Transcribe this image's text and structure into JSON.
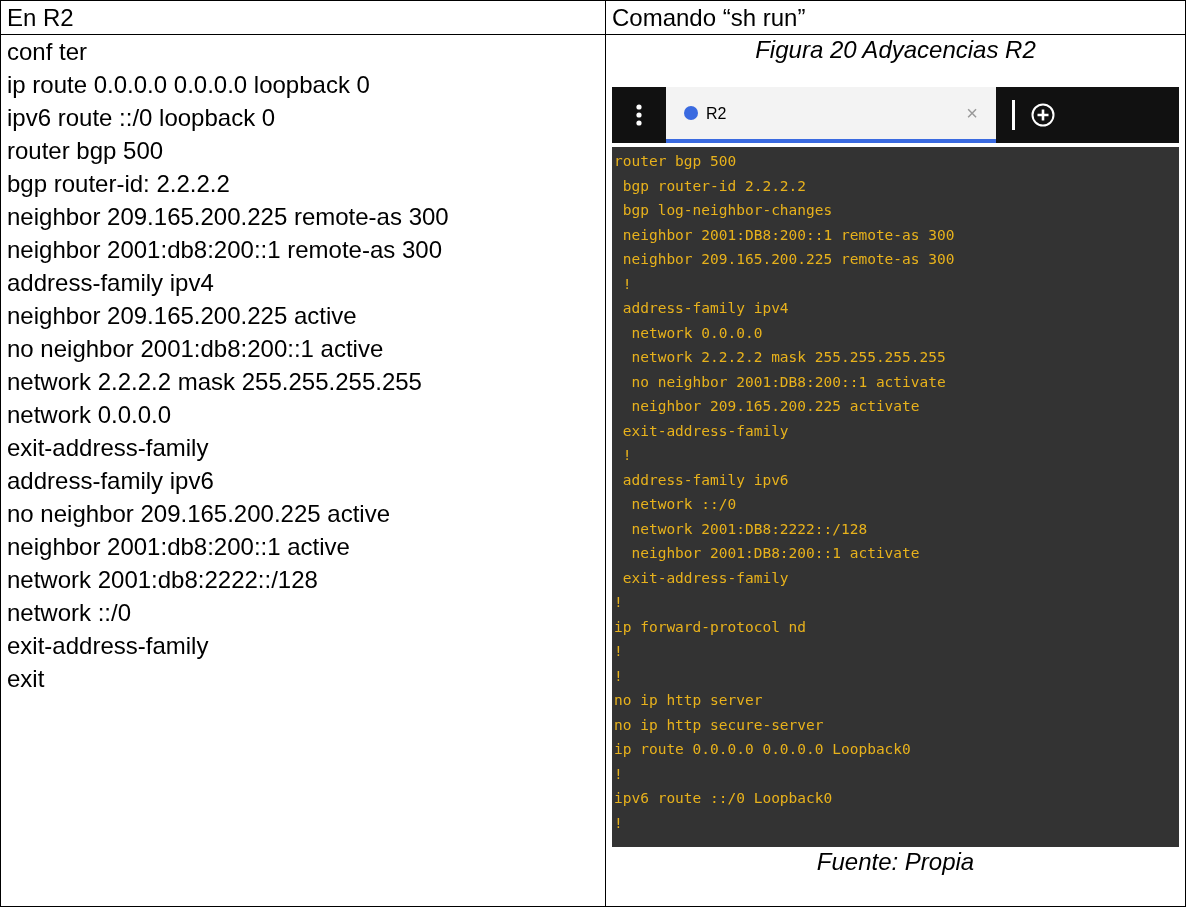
{
  "table": {
    "header": [
      "En R2",
      "Comando “sh run”"
    ],
    "commands": [
      "conf ter",
      "ip route 0.0.0.0 0.0.0.0 loopback 0",
      "ipv6 route ::/0 loopback 0",
      "router bgp 500",
      "bgp router-id: 2.2.2.2",
      "neighbor 209.165.200.225 remote-as 300",
      "neighbor  2001:db8:200::1 remote-as 300",
      "address-family ipv4",
      "neighbor 209.165.200.225 active",
      "no neighbor 2001:db8:200::1 active",
      "network 2.2.2.2 mask 255.255.255.255",
      "network 0.0.0.0",
      "exit-address-family",
      "address-family ipv6",
      "no neighbor 209.165.200.225 active",
      "neighbor 2001:db8:200::1 active",
      "network 2001:db8:2222::/128",
      "network ::/0",
      "exit-address-family",
      "exit"
    ],
    "figure": {
      "caption": "Figura 20 Adyacencias R2",
      "terminal": {
        "tabs": [
          {
            "label": "R2",
            "selected": true,
            "close": "×"
          }
        ],
        "lines": [
          "router bgp 500",
          " bgp router-id 2.2.2.2",
          " bgp log-neighbor-changes",
          " neighbor 2001:DB8:200::1 remote-as 300",
          " neighbor 209.165.200.225 remote-as 300",
          " !",
          " address-family ipv4",
          "  network 0.0.0.0",
          "  network 2.2.2.2 mask 255.255.255.255",
          "  no neighbor 2001:DB8:200::1 activate",
          "  neighbor 209.165.200.225 activate",
          " exit-address-family",
          " !",
          " address-family ipv6",
          "  network ::/0",
          "  network 2001:DB8:2222::/128",
          "  neighbor 2001:DB8:200::1 activate",
          " exit-address-family",
          "!",
          "ip forward-protocol nd",
          "!",
          "!",
          "no ip http server",
          "no ip http secure-server",
          "ip route 0.0.0.0 0.0.0.0 Loopback0",
          "!",
          "ipv6 route ::/0 Loopback0",
          "!"
        ]
      },
      "source": "Fuente: Propia"
    }
  }
}
